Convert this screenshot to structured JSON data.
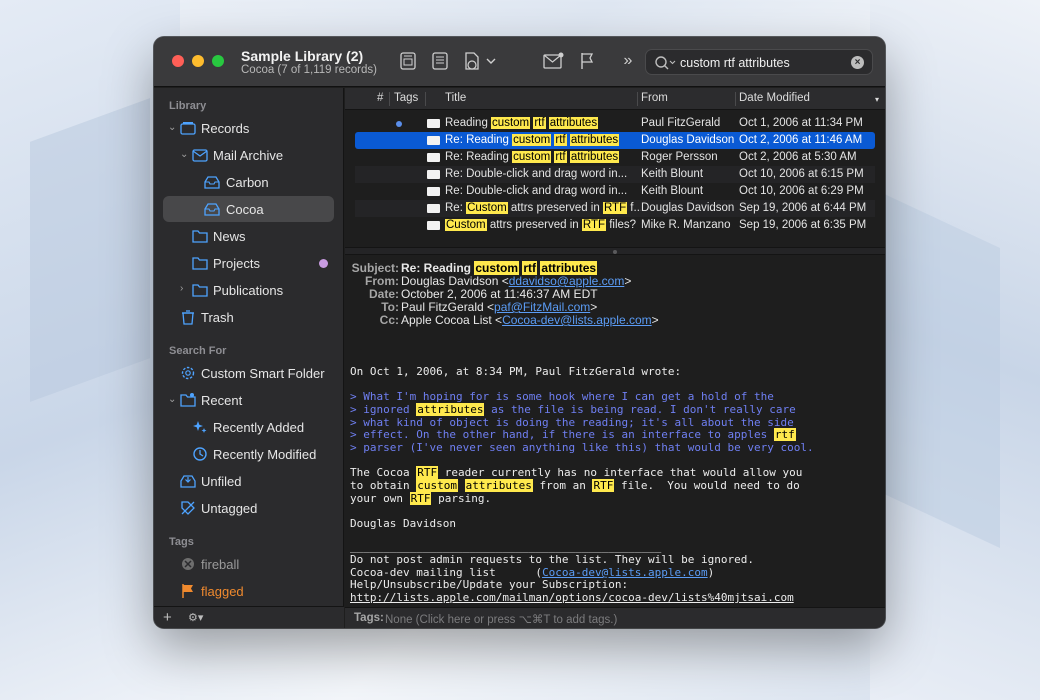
{
  "window": {
    "title": "Sample Library (2)",
    "subtitle": "Cocoa (7 of 1,119 records)"
  },
  "toolbar": {
    "search_value": "custom rtf attributes",
    "icons": [
      "rich-text-icon",
      "note-icon",
      "share-icon",
      "compose-mail-icon",
      "flag-icon",
      "overflow-icon",
      "search-icon",
      "clear-icon"
    ]
  },
  "sidebar": {
    "library_label": "Library",
    "records": "Records",
    "mail_archive": "Mail Archive",
    "carbon": "Carbon",
    "cocoa": "Cocoa",
    "news": "News",
    "projects": "Projects",
    "publications": "Publications",
    "trash": "Trash",
    "search_for_label": "Search For",
    "custom_smart_folder": "Custom Smart Folder",
    "recent": "Recent",
    "recently_added": "Recently Added",
    "recently_modified": "Recently Modified",
    "unfiled": "Unfiled",
    "untagged": "Untagged",
    "tags_label": "Tags",
    "tag_fireball": "fireball",
    "tag_flagged": "flagged",
    "colors": {
      "accent": "#0a5ad4",
      "projects_dot": "#c89be0",
      "flagged": "#f08a2e"
    }
  },
  "list": {
    "columns": {
      "num": "#",
      "tags": "Tags",
      "title": "Title",
      "from": "From",
      "date": "Date Modified"
    },
    "rows": [
      {
        "title_parts": [
          "Reading ",
          "custom",
          " ",
          "rtf",
          " ",
          "attributes"
        ],
        "from": "Paul FitzGerald",
        "date": "Oct 1, 2006 at 11:34 PM",
        "unread": true
      },
      {
        "title_parts": [
          "Re: Reading ",
          "custom",
          " ",
          "rtf",
          " ",
          "attributes"
        ],
        "from": "Douglas Davidson",
        "date": "Oct 2, 2006 at 11:46 AM",
        "selected": true
      },
      {
        "title_parts": [
          "Re: Reading ",
          "custom",
          " ",
          "rtf",
          " ",
          "attributes"
        ],
        "from": "Roger Persson",
        "date": "Oct 2, 2006 at 5:30 AM"
      },
      {
        "title_parts": [
          "Re: Double-click and drag word in..."
        ],
        "from": "Keith Blount",
        "date": "Oct 10, 2006 at 6:15 PM"
      },
      {
        "title_parts": [
          "Re: Double-click and drag word in..."
        ],
        "from": "Keith Blount",
        "date": "Oct 10, 2006 at 6:29 PM"
      },
      {
        "title_parts": [
          "Re: ",
          "Custom",
          " attrs preserved in ",
          "RTF",
          " f..."
        ],
        "from": "Douglas Davidson",
        "date": "Sep 19, 2006 at 6:44 PM"
      },
      {
        "title_parts": [
          "Custom",
          " attrs preserved in ",
          "RTF",
          " files?"
        ],
        "from": "Mike R. Manzano",
        "date": "Sep 19, 2006 at 6:35 PM"
      }
    ]
  },
  "message": {
    "subject_key": "Subject:",
    "subject_pre": "Re: Reading ",
    "subject_h1": "custom",
    "subject_h2": "rtf",
    "subject_h3": "attributes",
    "from_key": "From:",
    "from_name": "Douglas Davidson <",
    "from_email": "ddavidso@apple.com",
    "date_key": "Date:",
    "date_val": "October 2, 2006 at 11:46:37 AM EDT",
    "to_key": "To:",
    "to_name": "Paul FitzGerald <",
    "to_email": "paf@FitzMail.com",
    "cc_key": "Cc:",
    "cc_name": "Apple Cocoa List <",
    "cc_email": "Cocoa-dev@lists.apple.com",
    "close_angle": ">",
    "wrote_line": "On Oct 1, 2006, at 8:34 PM, Paul FitzGerald wrote:",
    "quote1": "> What I'm hoping for is some hook where I can get a hold of the",
    "quote2_pre": "> ignored ",
    "quote2_h": "attributes",
    "quote2_post": " as the file is being read. I don't really care",
    "quote3": "> what kind of object is doing the reading; it's all about the side",
    "quote4_pre": "> effect. On the other hand, if there is an interface to apples ",
    "quote4_h": "rtf",
    "quote5": "> parser (I've never seen anything like this) that would be very cool.",
    "body1_pre": "The Cocoa ",
    "body1_h": "RTF",
    "body1_post": " reader currently has no interface that would allow you",
    "body2_pre": "to obtain ",
    "body2_h1": "custom",
    "body2_h2": "attributes",
    "body2_mid": " from an ",
    "body2_h3": "RTF",
    "body2_post": " file.  You would need to do",
    "body3_pre": "your own ",
    "body3_h": "RTF",
    "body3_post": " parsing.",
    "signature": "Douglas Davidson",
    "rule": "_______________________________________________",
    "footer1": "Do not post admin requests to the list. They will be ignored.",
    "footer2_pre": "Cocoa-dev mailing list      (",
    "footer2_link": "Cocoa-dev@lists.apple.com",
    "footer2_post": ")",
    "footer3": "Help/Unsubscribe/Update your Subscription:",
    "footer4_link": "http://lists.apple.com/mailman/options/cocoa-dev/lists%40mjtsai.com"
  },
  "tagsbar": {
    "label": "Tags:",
    "placeholder": "None (Click here or press ⌥⌘T to add tags.)"
  },
  "bottom_bar": {
    "add": "+",
    "gear": "⚙︎▾"
  }
}
